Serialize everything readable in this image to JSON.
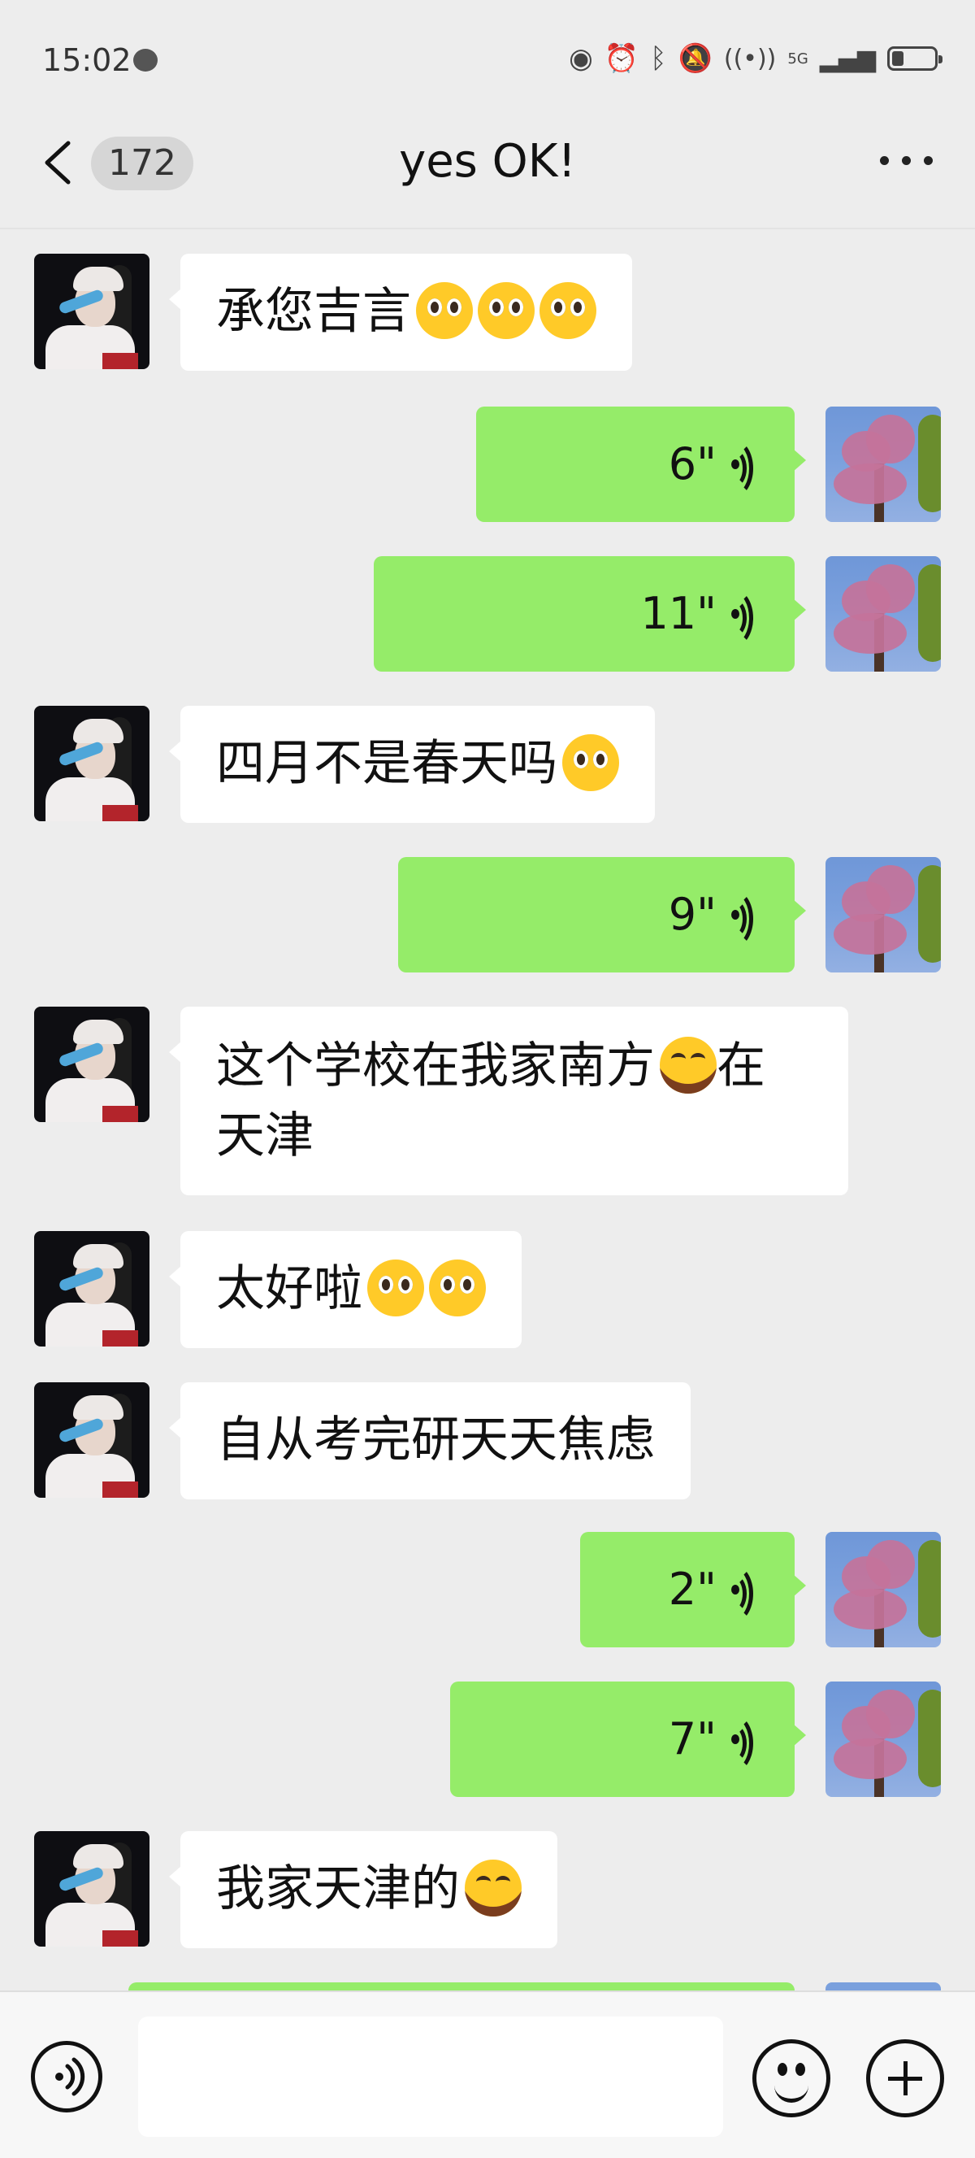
{
  "status_bar": {
    "time": "15:02",
    "network": "5G"
  },
  "header": {
    "unread_count": "172",
    "title": "yes OK!"
  },
  "messages": [
    {
      "side": "left",
      "type": "text",
      "text": "承您吉言",
      "emoji": [
        "pleading-face-icon",
        "pleading-face-icon",
        "pleading-face-icon"
      ]
    },
    {
      "side": "right",
      "type": "voice",
      "duration": "6\""
    },
    {
      "side": "right",
      "type": "voice",
      "duration": "11\""
    },
    {
      "side": "left",
      "type": "text",
      "text": "四月不是春天吗",
      "emoji": [
        "pleading-face-icon"
      ]
    },
    {
      "side": "right",
      "type": "voice",
      "duration": "9\""
    },
    {
      "side": "left",
      "type": "text",
      "text_line1": "这个学校在我家南方",
      "text_after_emoji": "在",
      "text_line2": "天津",
      "emoji": [
        "laughing-tears-icon"
      ]
    },
    {
      "side": "left",
      "type": "text",
      "text": "太好啦",
      "emoji": [
        "pleading-face-icon",
        "pleading-face-icon"
      ]
    },
    {
      "side": "left",
      "type": "text",
      "text": "自从考完研天天焦虑"
    },
    {
      "side": "right",
      "type": "voice",
      "duration": "2\""
    },
    {
      "side": "right",
      "type": "voice",
      "duration": "7\""
    },
    {
      "side": "left",
      "type": "text",
      "text": "我家天津的",
      "emoji": [
        "laughing-tears-icon"
      ]
    }
  ],
  "input_bar": {
    "placeholder": ""
  },
  "colors": {
    "sent_bubble": "#95ec69",
    "received_bubble": "#ffffff",
    "background": "#ededed"
  }
}
